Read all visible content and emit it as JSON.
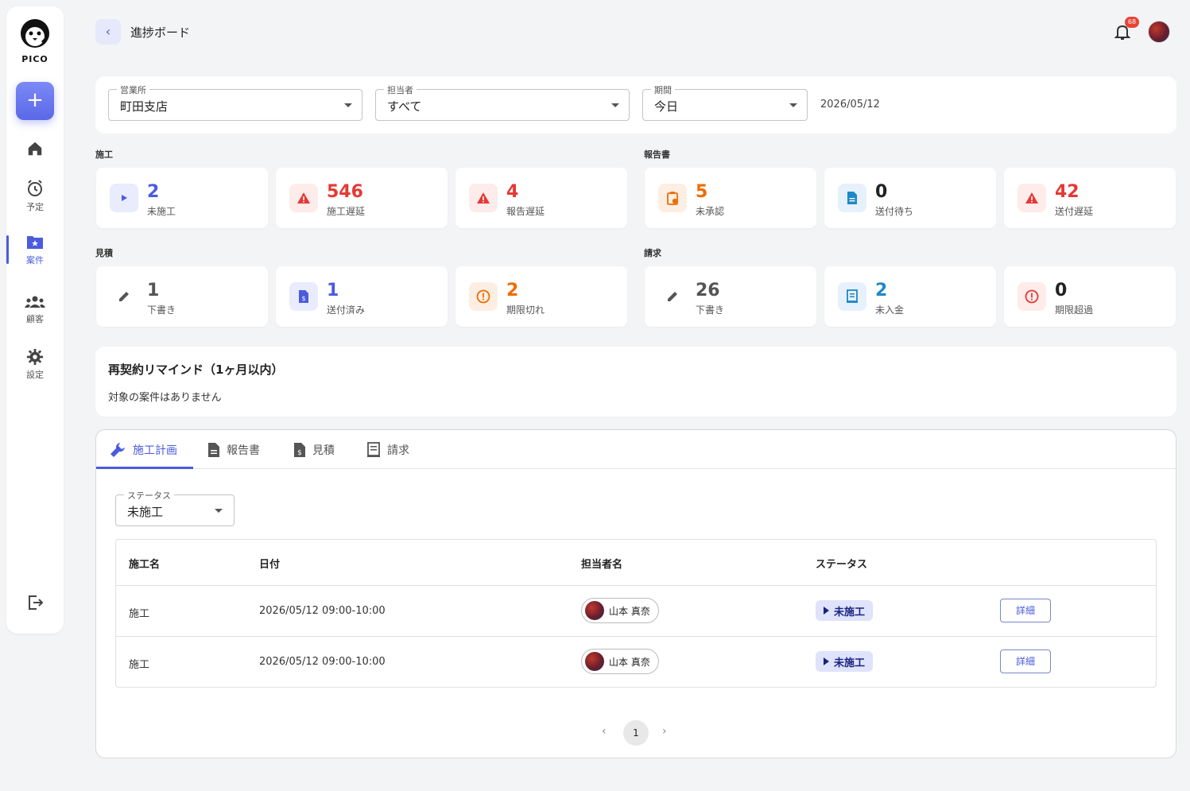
{
  "app": {
    "name": "PICO"
  },
  "header": {
    "title": "進捗ボード",
    "notification_count": "68"
  },
  "sidebar": {
    "items": [
      {
        "label": ""
      },
      {
        "label": "予定"
      },
      {
        "label": "案件"
      },
      {
        "label": "顧客"
      },
      {
        "label": "設定"
      }
    ]
  },
  "filters": {
    "office": {
      "legend": "営業所",
      "value": "町田支店"
    },
    "assignee": {
      "legend": "担当者",
      "value": "すべて"
    },
    "period": {
      "legend": "期間",
      "value": "今日"
    },
    "date": "2026/05/12"
  },
  "sections": {
    "construction": {
      "label": "施工",
      "stats": [
        {
          "value": "2",
          "label": "未施工"
        },
        {
          "value": "546",
          "label": "施工遅延"
        },
        {
          "value": "4",
          "label": "報告遅延"
        }
      ]
    },
    "report": {
      "label": "報告書",
      "stats": [
        {
          "value": "5",
          "label": "未承認"
        },
        {
          "value": "0",
          "label": "送付待ち"
        },
        {
          "value": "42",
          "label": "送付遅延"
        }
      ]
    },
    "estimate": {
      "label": "見積",
      "stats": [
        {
          "value": "1",
          "label": "下書き"
        },
        {
          "value": "1",
          "label": "送付済み"
        },
        {
          "value": "2",
          "label": "期限切れ"
        }
      ]
    },
    "invoice": {
      "label": "請求",
      "stats": [
        {
          "value": "26",
          "label": "下書き"
        },
        {
          "value": "2",
          "label": "未入金"
        },
        {
          "value": "0",
          "label": "期限超過"
        }
      ]
    }
  },
  "remind": {
    "title": "再契約リマインド（1ヶ月以内）",
    "body": "対象の案件はありません"
  },
  "tabs": [
    {
      "label": "施工計画"
    },
    {
      "label": "報告書"
    },
    {
      "label": "見積"
    },
    {
      "label": "請求"
    }
  ],
  "status_filter": {
    "legend": "ステータス",
    "value": "未施工"
  },
  "table": {
    "headers": [
      "施工名",
      "日付",
      "担当者名",
      "ステータス"
    ],
    "rows": [
      {
        "name": "施工",
        "date": "2026/05/12 09:00-10:00",
        "person": "山本 真奈",
        "status": "未施工",
        "action": "詳細"
      },
      {
        "name": "施工",
        "date": "2026/05/12 09:00-10:00",
        "person": "山本 真奈",
        "status": "未施工",
        "action": "詳細"
      }
    ]
  },
  "pagination": {
    "current": "1",
    "prev": "‹",
    "next": "›"
  },
  "add_button": "+"
}
